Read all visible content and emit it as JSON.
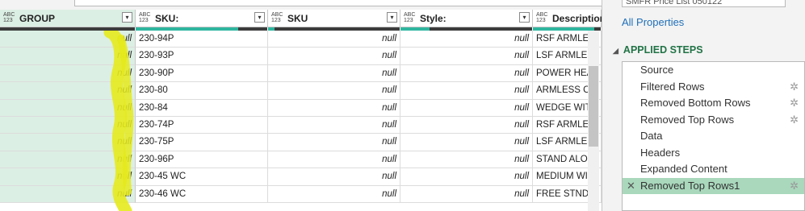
{
  "top": {
    "name_box_text": "SMFR Price List 050122"
  },
  "columns": [
    {
      "type": "ABC\n123",
      "name": "GROUP",
      "selected": true
    },
    {
      "type": "ABC\n123",
      "name": "SKU:",
      "selected": false
    },
    {
      "type": "ABC\n123",
      "name": "SKU",
      "selected": false
    },
    {
      "type": "ABC\n123",
      "name": "Style:",
      "selected": false
    },
    {
      "type": "ABC\n123",
      "name": "Description",
      "selected": false
    }
  ],
  "rows": [
    [
      "null",
      "230-94P",
      "null",
      "null",
      "RSF ARMLES"
    ],
    [
      "null",
      "230-93P",
      "null",
      "null",
      "LSF ARMLES"
    ],
    [
      "null",
      "230-90P",
      "null",
      "null",
      "POWER HEA"
    ],
    [
      "null",
      "230-80",
      "null",
      "null",
      "ARMLESS CH"
    ],
    [
      "null",
      "230-84",
      "null",
      "null",
      "WEDGE WIT"
    ],
    [
      "null",
      "230-74P",
      "null",
      "null",
      "RSF ARMLES"
    ],
    [
      "null",
      "230-75P",
      "null",
      "null",
      "LSF ARMLES"
    ],
    [
      "null",
      "230-96P",
      "null",
      "null",
      "STAND ALON"
    ],
    [
      "null",
      "230-45 WC",
      "null",
      "null",
      "MEDIUM WI"
    ],
    [
      "null",
      "230-46 WC",
      "null",
      "null",
      "FREE STNDN"
    ]
  ],
  "column_quality_valid": [
    0,
    0.78,
    0.05,
    0.22,
    0.9
  ],
  "pane": {
    "all_properties": "All Properties",
    "applied_steps_title": "APPLIED STEPS",
    "steps": [
      {
        "label": "Source",
        "gear": false,
        "selected": false
      },
      {
        "label": "Filtered Rows",
        "gear": true,
        "selected": false
      },
      {
        "label": "Removed Bottom Rows",
        "gear": true,
        "selected": false
      },
      {
        "label": "Removed Top Rows",
        "gear": true,
        "selected": false
      },
      {
        "label": "Data",
        "gear": false,
        "selected": false
      },
      {
        "label": "Headers",
        "gear": false,
        "selected": false
      },
      {
        "label": "Expanded Content",
        "gear": false,
        "selected": false
      },
      {
        "label": "Removed Top Rows1",
        "gear": true,
        "selected": true
      }
    ]
  },
  "colors": {
    "accent_green": "#217346",
    "selected_column": "#dcefe4",
    "selected_step": "#a9d8bc",
    "quality_valid": "#2fb6a0",
    "highlighter": "#e5ea1c"
  },
  "icons": {
    "dropdown": "▾",
    "gear": "✲",
    "delete": "✕",
    "collapse": "◢"
  }
}
